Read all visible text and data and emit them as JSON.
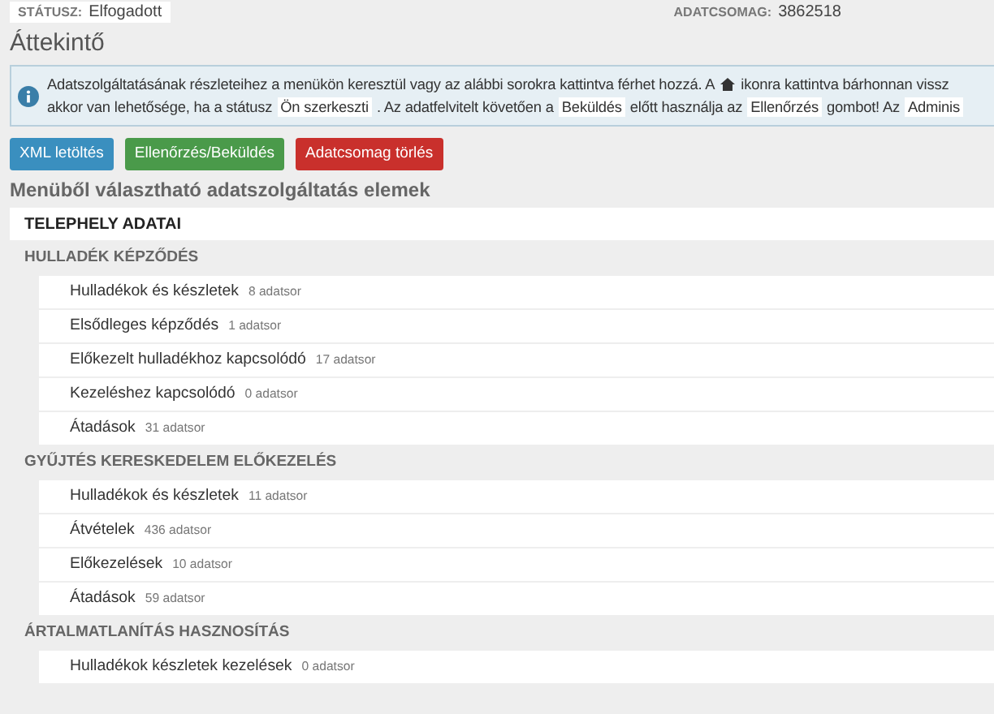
{
  "status": {
    "label": "STÁTUSZ:",
    "value": "Elfogadott"
  },
  "package": {
    "label": "ADATCSOMAG:",
    "value": "3862518"
  },
  "title": "Áttekintő",
  "info": {
    "line_1_before": "Adatszolgáltatásának részleteihez a menükön keresztül vagy az alábbi sorokra kattintva férhet hozzá. A",
    "line_1_after": "ikonra kattintva bárhonnan vissz",
    "line_2": [
      {
        "kind": "text",
        "text": "akkor van lehetősége, ha a státusz"
      },
      {
        "kind": "chip",
        "text": "Ön szerkeszti"
      },
      {
        "kind": "text",
        "text": ". Az adatfelvitelt követően a"
      },
      {
        "kind": "chip",
        "text": "Beküldés"
      },
      {
        "kind": "text",
        "text": "előtt használja az"
      },
      {
        "kind": "chip",
        "text": "Ellenőrzés"
      },
      {
        "kind": "text",
        "text": "gombot! Az"
      },
      {
        "kind": "chip",
        "text": "Adminis"
      }
    ]
  },
  "buttons": [
    {
      "label": "XML letöltés",
      "kind": "info"
    },
    {
      "label": "Ellenőrzés/Beküldés",
      "kind": "success"
    },
    {
      "label": "Adatcsomag törlés",
      "kind": "danger"
    }
  ],
  "section_title": "Menüből választható adatszolgáltatás elemek",
  "site_row": "TELEPHELY ADATAI",
  "groups": [
    {
      "title": "HULLADÉK KÉPZŐDÉS",
      "items": [
        {
          "name": "Hulladékok és készletek",
          "count": "8 adatsor"
        },
        {
          "name": "Elsődleges képződés",
          "count": "1 adatsor"
        },
        {
          "name": "Előkezelt hulladékhoz kapcsolódó",
          "count": "17 adatsor"
        },
        {
          "name": "Kezeléshez kapcsolódó",
          "count": "0 adatsor"
        },
        {
          "name": "Átadások",
          "count": "31 adatsor"
        }
      ]
    },
    {
      "title": "GYŰJTÉS KERESKEDELEM ELŐKEZELÉS",
      "items": [
        {
          "name": "Hulladékok és készletek",
          "count": "11 adatsor"
        },
        {
          "name": "Átvételek",
          "count": "436 adatsor"
        },
        {
          "name": "Előkezelések",
          "count": "10 adatsor"
        },
        {
          "name": "Átadások",
          "count": "59 adatsor"
        }
      ]
    },
    {
      "title": "ÁRTALMATLANÍTÁS HASZNOSÍTÁS",
      "items": [
        {
          "name": "Hulladékok készletek kezelések",
          "count": "0 adatsor"
        }
      ]
    }
  ]
}
